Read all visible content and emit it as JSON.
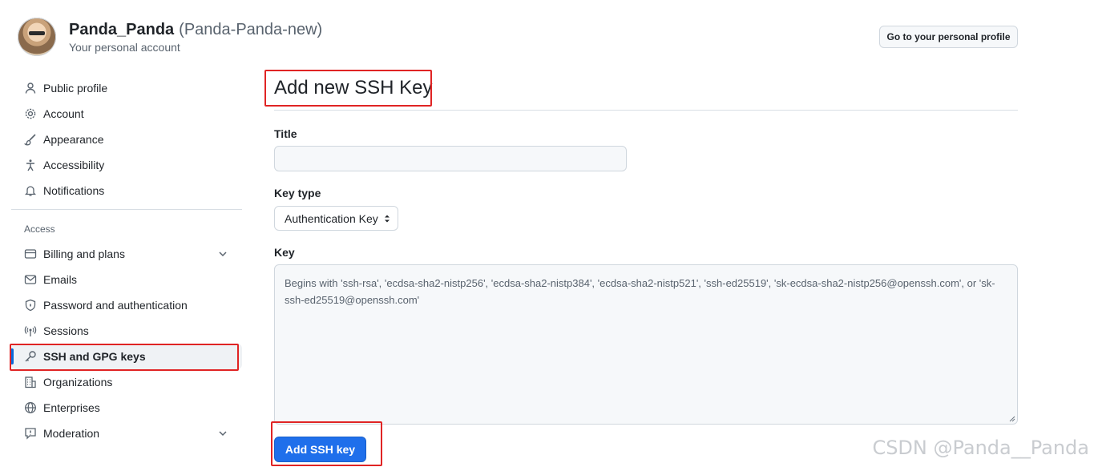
{
  "account": {
    "name": "Panda_Panda",
    "login": "(Panda-Panda-new)",
    "subtitle": "Your personal account",
    "profile_button": "Go to your personal profile"
  },
  "sidebar": {
    "items": [
      {
        "label": "Public profile",
        "icon": "person-icon"
      },
      {
        "label": "Account",
        "icon": "gear-icon"
      },
      {
        "label": "Appearance",
        "icon": "paintbrush-icon"
      },
      {
        "label": "Accessibility",
        "icon": "accessibility-icon"
      },
      {
        "label": "Notifications",
        "icon": "bell-icon"
      }
    ],
    "access_heading": "Access",
    "access_items": [
      {
        "label": "Billing and plans",
        "icon": "credit-card-icon",
        "expandable": true
      },
      {
        "label": "Emails",
        "icon": "mail-icon"
      },
      {
        "label": "Password and authentication",
        "icon": "shield-lock-icon"
      },
      {
        "label": "Sessions",
        "icon": "broadcast-icon"
      },
      {
        "label": "SSH and GPG keys",
        "icon": "key-icon",
        "active": true
      },
      {
        "label": "Organizations",
        "icon": "organization-icon"
      },
      {
        "label": "Enterprises",
        "icon": "globe-icon"
      },
      {
        "label": "Moderation",
        "icon": "report-icon",
        "expandable": true
      }
    ]
  },
  "main": {
    "title": "Add new SSH Key",
    "title_field_label": "Title",
    "title_field_value": "",
    "key_type_label": "Key type",
    "key_type_value": "Authentication Key",
    "key_label": "Key",
    "key_placeholder": "Begins with 'ssh-rsa', 'ecdsa-sha2-nistp256', 'ecdsa-sha2-nistp384', 'ecdsa-sha2-nistp521', 'ssh-ed25519', 'sk-ecdsa-sha2-nistp256@openssh.com', or 'sk-ssh-ed25519@openssh.com'",
    "submit_button": "Add SSH key"
  },
  "watermark": "CSDN @Panda__Panda",
  "colors": {
    "accent": "#1f6feb",
    "highlight_box": "#e02424",
    "active_indicator": "#0969da"
  }
}
